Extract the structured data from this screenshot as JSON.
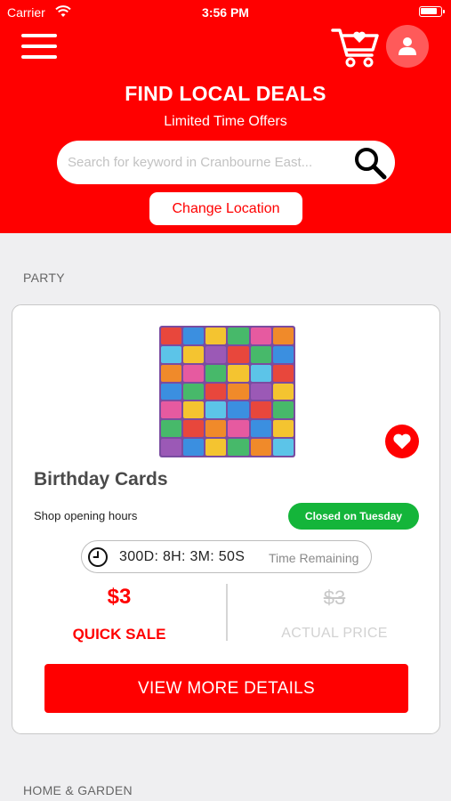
{
  "status_bar": {
    "carrier": "Carrier",
    "time": "3:56 PM"
  },
  "header": {
    "title": "FIND LOCAL DEALS",
    "subtitle": "Limited Time Offers",
    "search_placeholder": "Search for keyword in Cranbourne East...",
    "change_location_label": "Change Location"
  },
  "sections": [
    {
      "label": "PARTY"
    },
    {
      "label": "HOME & GARDEN"
    }
  ],
  "deal": {
    "name": "Birthday Cards",
    "hours_label": "Shop opening hours",
    "hours_status": "Closed on Tuesday",
    "time_remaining": "300D:  8H:  3M:  50S",
    "time_remaining_label": "Time Remaining",
    "sale_price": "$3",
    "sale_label": "QUICK SALE",
    "actual_price": "$3",
    "actual_label": "ACTUAL PRICE",
    "cta_label": "VIEW MORE DETAILS"
  },
  "colors": {
    "brand_red": "#ff0000",
    "open_green": "#14b53a",
    "background": "#efeff1"
  },
  "icons": [
    "wifi-icon",
    "battery-icon",
    "hamburger-icon",
    "cart-icon",
    "user-icon",
    "search-icon",
    "heart-icon",
    "clock-icon"
  ]
}
